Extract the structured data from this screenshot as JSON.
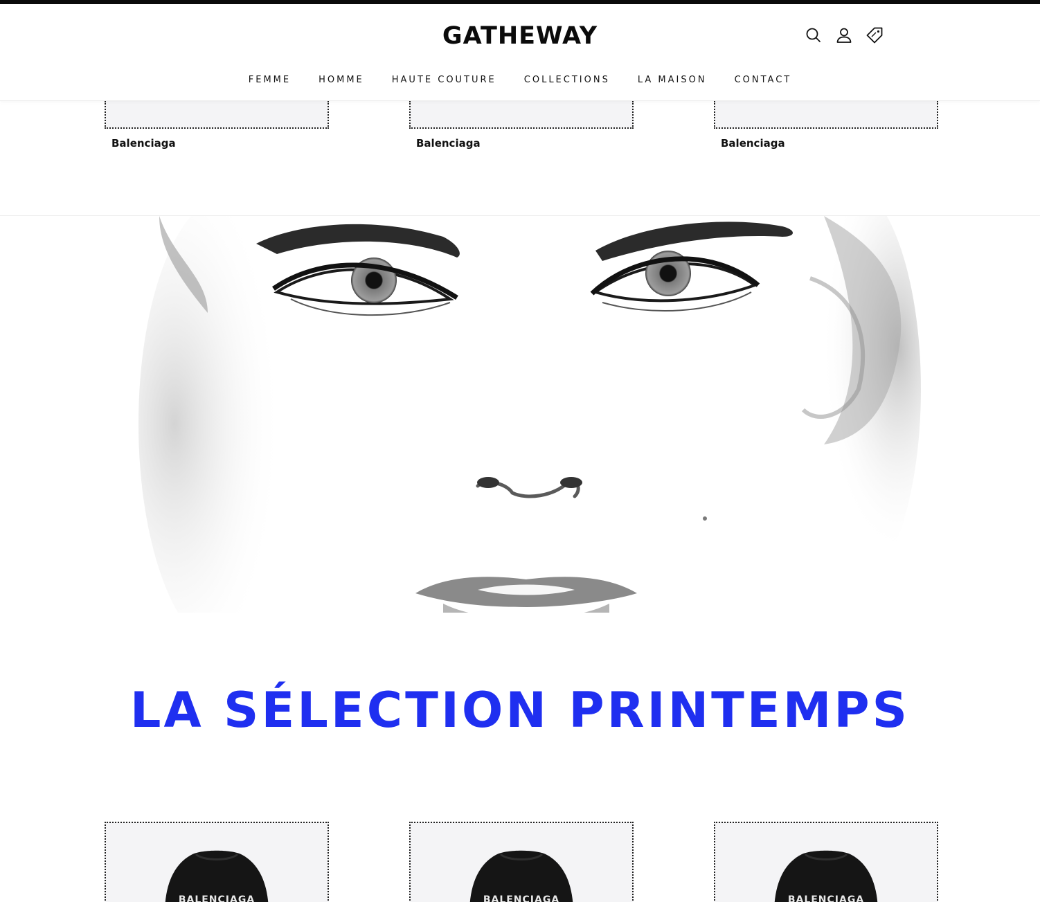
{
  "header": {
    "logo": "GATHEWAY",
    "icons": [
      "search-icon",
      "user-icon",
      "tag-icon"
    ],
    "nav": [
      "FEMME",
      "HOMME",
      "HAUTE COUTURE",
      "COLLECTIONS",
      "LA MAISON",
      "CONTACT"
    ]
  },
  "previous_products": [
    {
      "brand": "Balenciaga"
    },
    {
      "brand": "Balenciaga"
    },
    {
      "brand": "Balenciaga"
    }
  ],
  "hero": {
    "image": "black-and-white-woman-face-portrait"
  },
  "selection": {
    "title": "LA SÉLECTION PRINTEMPS",
    "title_color": "#1f2ff0",
    "products": [
      {
        "image": "black-hoodie",
        "print": "BALENCIAGA"
      },
      {
        "image": "black-hoodie",
        "print": "BALENCIAGA"
      },
      {
        "image": "black-hoodie",
        "print": "BALENCIAGA"
      }
    ]
  }
}
